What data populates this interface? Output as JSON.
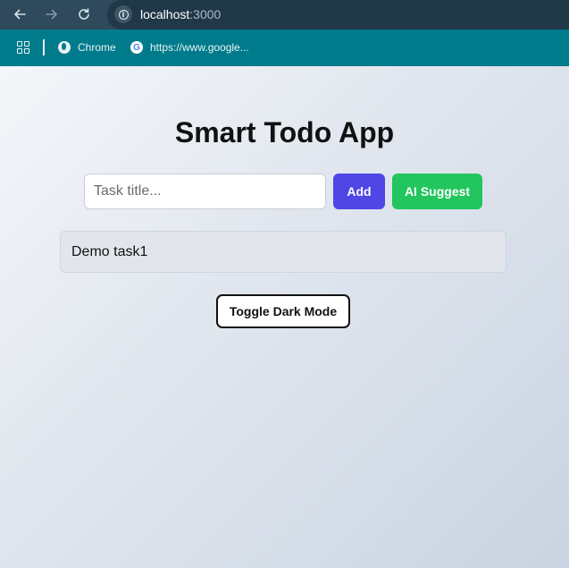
{
  "browser": {
    "url_host": "localhost",
    "url_port": ":3000",
    "icons": {
      "back": "arrow-left-icon",
      "forward": "arrow-right-icon",
      "reload": "reload-icon",
      "site_info": "info-icon"
    },
    "bookmarks": {
      "items": [
        {
          "label": "Chrome",
          "icon": "globe-icon"
        },
        {
          "label": "https://www.google...",
          "icon": "google-icon"
        }
      ]
    }
  },
  "app": {
    "title": "Smart Todo App",
    "input": {
      "placeholder": "Task title...",
      "value": ""
    },
    "add_label": "Add",
    "ai_suggest_label": "AI Suggest",
    "tasks": [
      {
        "title": "Demo task1"
      }
    ],
    "toggle_dark_label": "Toggle Dark Mode"
  },
  "colors": {
    "add_button": "#4f46e5",
    "ai_button": "#22c55e",
    "bookmark_bar": "#007b8c",
    "toolbar": "#2f4a5c"
  }
}
